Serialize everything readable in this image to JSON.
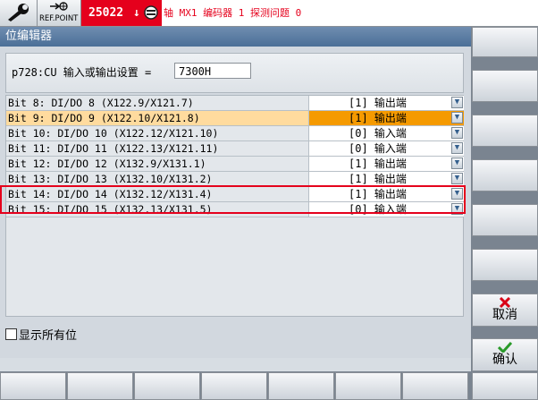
{
  "topbar": {
    "wrench_icon": "wrench-icon",
    "ref_point_label": "REF.POINT",
    "alarm_code": "25022",
    "alarm_text": "轴 MX1 编码器 1 探测问题 0"
  },
  "dialog": {
    "title": "位编辑器",
    "param_label": "p728:CU 输入或输出设置 =",
    "param_value": "7300H",
    "rows": [
      {
        "label": "Bit 8: DI/DO 8 (X122.9/X121.7)",
        "value": "[1] 输出端"
      },
      {
        "label": "Bit 9: DI/DO 9 (X122.10/X121.8)",
        "value": "[1] 输出端"
      },
      {
        "label": "Bit 10: DI/DO 10 (X122.12/X121.10)",
        "value": "[0] 输入端"
      },
      {
        "label": "Bit 11: DI/DO 11 (X122.13/X121.11)",
        "value": "[0] 输入端"
      },
      {
        "label": "Bit 12: DI/DO 12 (X132.9/X131.1)",
        "value": "[1] 输出端"
      },
      {
        "label": "Bit 13: DI/DO 13 (X132.10/X131.2)",
        "value": "[1] 输出端"
      },
      {
        "label": "Bit 14: DI/DO 14 (X132.12/X131.4)",
        "value": "[1] 输出端"
      },
      {
        "label": "Bit 15: DI/DO 15 (X132.13/X131.5)",
        "value": "[0] 输入端"
      }
    ],
    "show_all_label": "显示所有位"
  },
  "softkeys": {
    "cancel_label": "取消",
    "ok_label": "确认"
  },
  "colors": {
    "alarm_red": "#e5001c",
    "title_blue": "#4b6f97",
    "selected_orange": "#f59a00",
    "ok_green": "#2a9a2a"
  }
}
